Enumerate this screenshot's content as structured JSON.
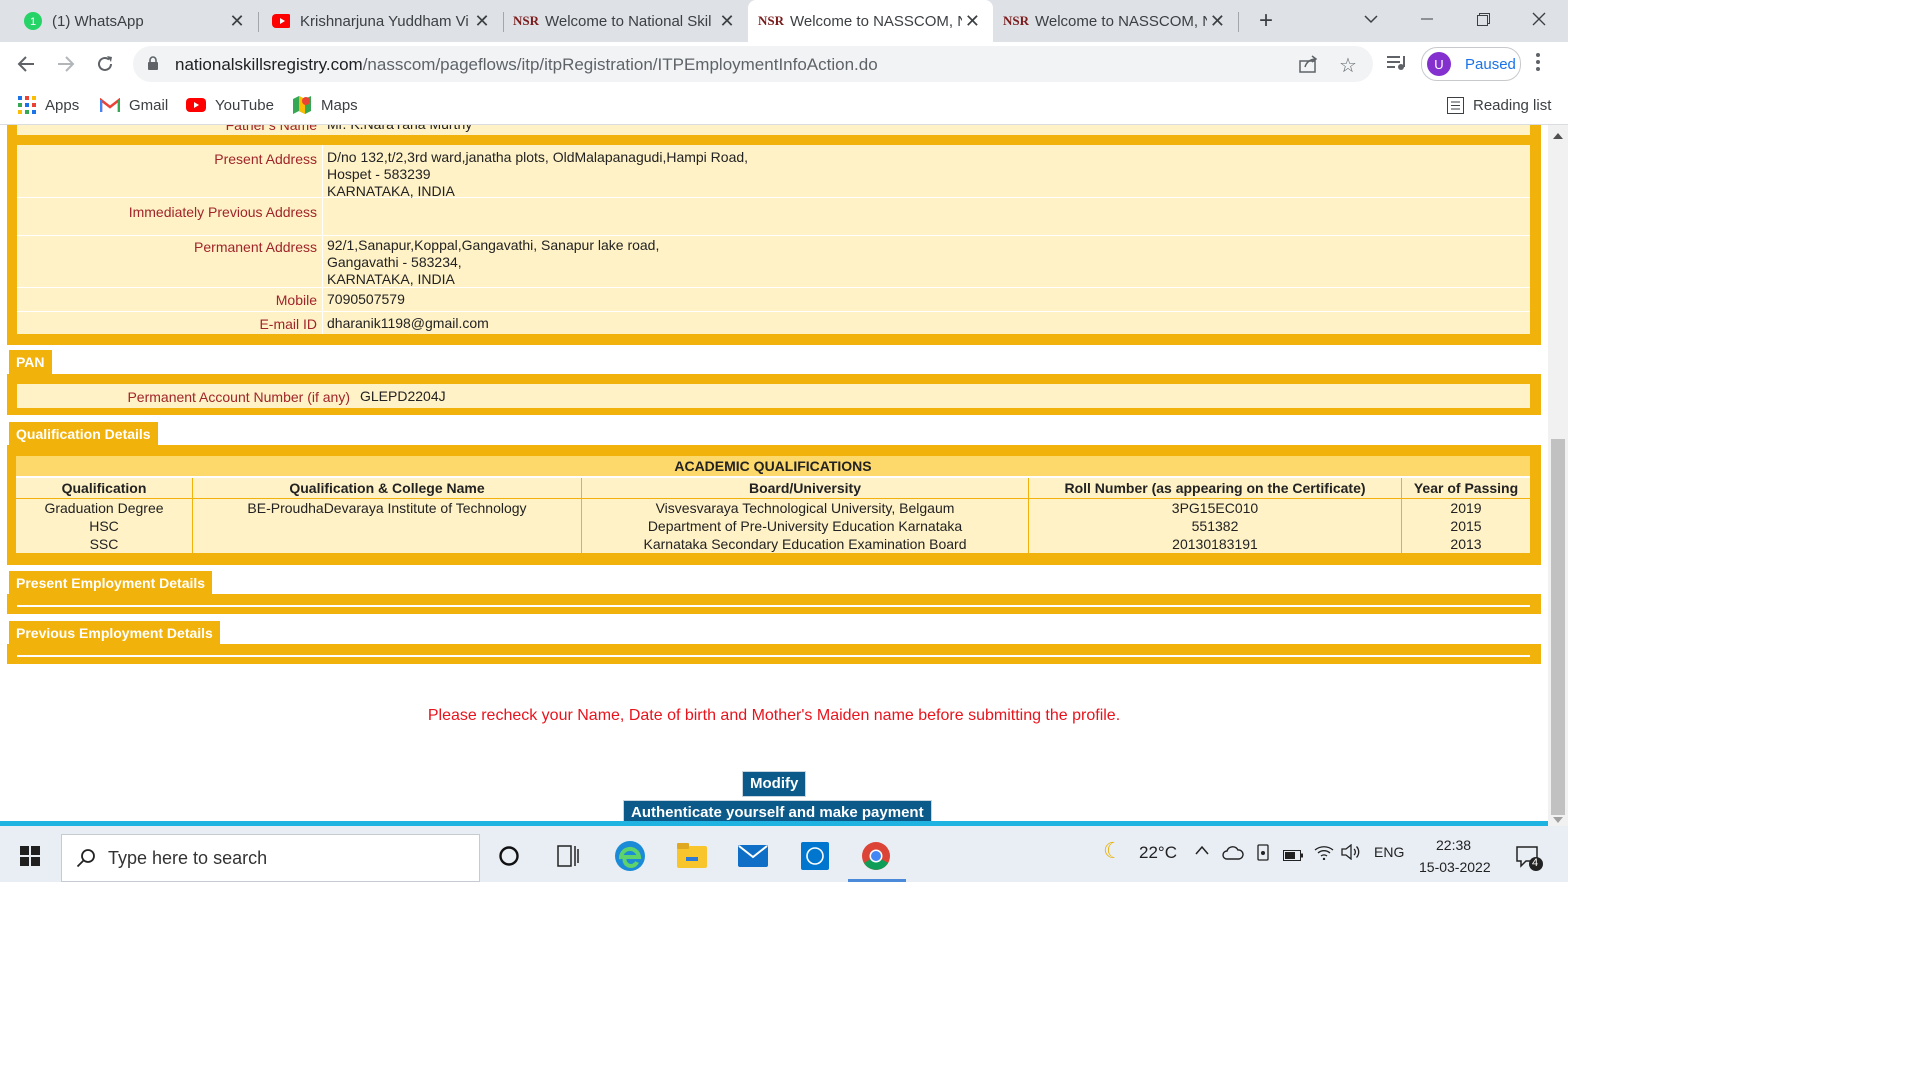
{
  "browser": {
    "tabs": [
      {
        "title": "(1) WhatsApp",
        "icon": "whatsapp-icon",
        "badge": "1"
      },
      {
        "title": "Krishnarjuna Yuddham Vi",
        "icon": "youtube-icon"
      },
      {
        "title": "Welcome to National Skil",
        "icon": "nsr-logo-icon"
      },
      {
        "title": "Welcome to NASSCOM, N",
        "icon": "nsr-logo-icon",
        "active": true
      },
      {
        "title": "Welcome to NASSCOM, N",
        "icon": "nsr-logo-icon"
      }
    ],
    "url_host": "nationalskillsregistry.com",
    "url_path": "/nasscom/pageflows/itp/itpRegistration/ITPEmploymentInfoAction.do",
    "profile_initial": "U",
    "profile_status": "Paused",
    "bookmarks": [
      "Apps",
      "Gmail",
      "YouTube",
      "Maps"
    ],
    "reading_list": "Reading list"
  },
  "personal": {
    "fathers_name_label": "Father's Name",
    "fathers_name_value": "Mr. K.NaraYana Murthy",
    "present_address_label": "Present Address",
    "present_address_lines": [
      "D/no 132,t/2,3rd ward,janatha plots,  OldMalapanagudi,Hampi Road,",
      "Hospet  -  583239",
      "KARNATAKA,  INDIA"
    ],
    "previous_address_label": "Immediately Previous Address",
    "permanent_address_label": "Permanent Address",
    "permanent_address_lines": [
      "92/1,Sanapur,Koppal,Gangavathi,  Sanapur lake road,",
      "Gangavathi  -  583234,",
      "KARNATAKA,  INDIA"
    ],
    "mobile_label": "Mobile",
    "mobile_value": "7090507579",
    "email_label": "E-mail ID",
    "email_value": "dharanik1198@gmail.com"
  },
  "pan": {
    "header": "PAN",
    "label": "Permanent Account Number (if any)",
    "value": "GLEPD2204J"
  },
  "qualification": {
    "header": "Qualification Details",
    "caption": "ACADEMIC QUALIFICATIONS",
    "columns": [
      "Qualification",
      "Qualification & College Name",
      "Board/University",
      "Roll Number (as appearing on the Certificate)",
      "Year of Passing"
    ],
    "rows": [
      [
        "Graduation Degree",
        "BE-ProudhaDevaraya Institute of Technology",
        "Visvesvaraya Technological University, Belgaum",
        "3PG15EC010",
        "2019"
      ],
      [
        "HSC",
        "",
        "Department of Pre-University Education Karnataka",
        "551382",
        "2015"
      ],
      [
        "SSC",
        "",
        "Karnataka Secondary Education Examination Board",
        "20130183191",
        "2013"
      ]
    ]
  },
  "present_employment_header": "Present Employment Details",
  "previous_employment_header": "Previous Employment Details",
  "warning": "Please recheck your Name, Date of birth and Mother's Maiden name before submitting the profile.",
  "buttons": {
    "modify": "Modify",
    "authenticate": "Authenticate yourself and make payment"
  },
  "taskbar": {
    "search_placeholder": "Type here to search",
    "weather": "22°C",
    "language": "ENG",
    "time": "22:38",
    "date": "15-03-2022",
    "notifications": "4"
  },
  "colors": {
    "section_gold": "#f2b20c",
    "row_cream": "#fff2c7",
    "label_red": "#a0252a",
    "button_blue": "#0b5a89",
    "warning_red": "#e8141d"
  }
}
